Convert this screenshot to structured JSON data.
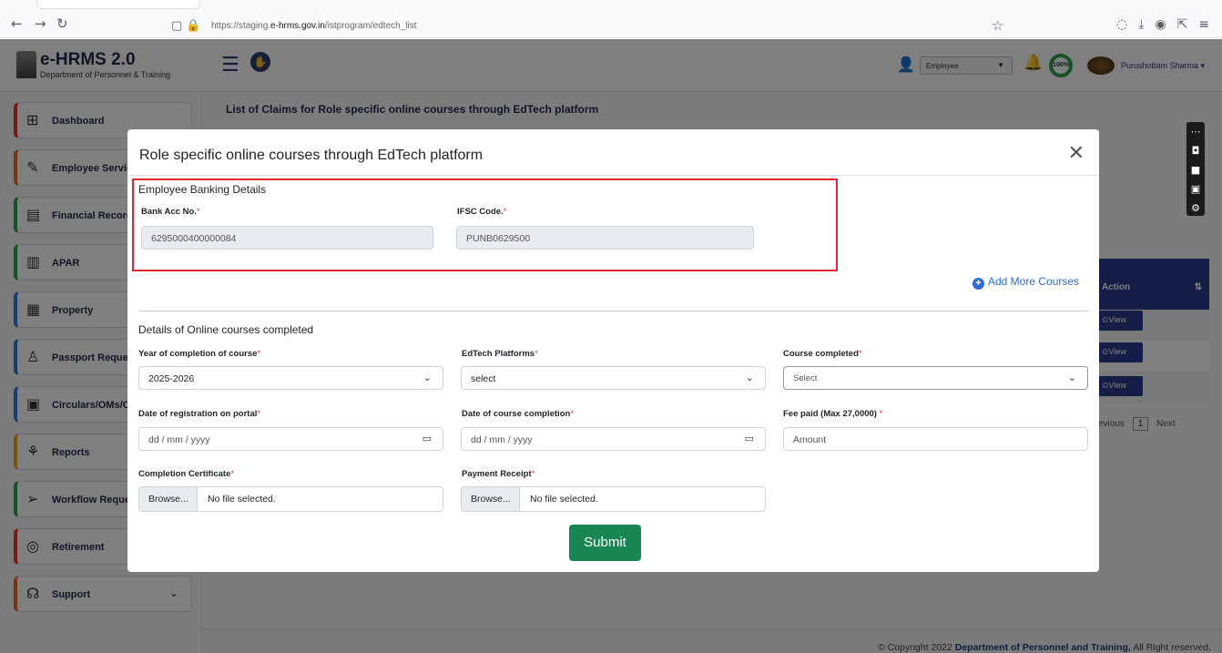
{
  "browser": {
    "url_prefix": "https://staging.",
    "url_domain": "e-hrms.gov.in",
    "url_path": "/istprogram/edtech_list"
  },
  "header": {
    "app_name": "e-HRMS 2.0",
    "department": "Department of Personnel & Training",
    "role_selected": "Employee",
    "profile_progress": "100%",
    "user_name": "Purushottam Sharma"
  },
  "sidebar": {
    "items": [
      {
        "label": "Dashboard",
        "icon": "dashboard-icon"
      },
      {
        "label": "Employee Service",
        "icon": "edit-icon"
      },
      {
        "label": "Financial Records",
        "icon": "records-icon"
      },
      {
        "label": "APAR",
        "icon": "document-icon"
      },
      {
        "label": "Property",
        "icon": "building-icon"
      },
      {
        "label": "Passport Request",
        "icon": "person-icon"
      },
      {
        "label": "Circulars/OMs/Or",
        "icon": "circular-icon"
      },
      {
        "label": "Reports",
        "icon": "reports-icon"
      },
      {
        "label": "Workflow Reques",
        "icon": "send-icon"
      },
      {
        "label": "Retirement",
        "icon": "retirement-icon"
      },
      {
        "label": "Support",
        "icon": "headset-icon"
      }
    ]
  },
  "main": {
    "title": "List of Claims for Role specific online courses through EdTech platform",
    "table_action_header": "Action",
    "view_label": "View",
    "pager_prev": "evious",
    "pager_page": "1",
    "pager_next": "Next"
  },
  "modal": {
    "title": "Role specific online courses through EdTech platform",
    "banking_section": "Employee Banking Details",
    "bank_acc_label": "Bank Acc No.",
    "bank_acc_value": "6295000400000084",
    "ifsc_label": "IFSC Code.",
    "ifsc_value": "PUNB0629500",
    "add_more_label": "Add More Courses",
    "courses_section": "Details of Online courses completed",
    "year_label": "Year of completion of course",
    "year_value": "2025-2026",
    "platform_label": "EdTech Platforms",
    "platform_value": "select",
    "course_label": "Course completed",
    "course_value": "Select",
    "reg_date_label": "Date of registration on portal",
    "reg_date_placeholder": "dd / mm / yyyy",
    "completion_date_label": "Date of course completion",
    "completion_date_placeholder": "dd / mm / yyyy",
    "fee_label": "Fee paid (Max 27,0000)",
    "fee_placeholder": "Amount",
    "certificate_label": "Completion Certificate",
    "receipt_label": "Payment Receipt",
    "browse_label": "Browse...",
    "no_file_label": "No file selected.",
    "required_mark": "*",
    "submit_label": "Submit"
  },
  "footer": {
    "copyright_prefix": "© Copyright 2022",
    "org": "Department of Personnel and Training,",
    "rights": "All Right reserved."
  },
  "colors": {
    "primary": "#2c3b8c",
    "submit": "#198754",
    "highlight": "#e3262e",
    "link": "#2c6cd1"
  }
}
